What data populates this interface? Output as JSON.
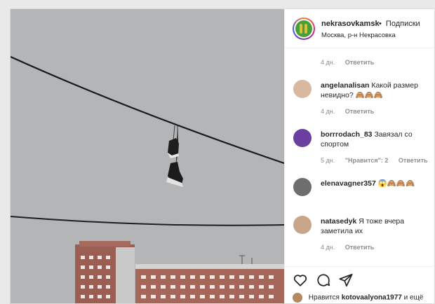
{
  "post": {
    "username": "nekrasovkamsk",
    "follow_separator": "•",
    "follow_label": "Подписки",
    "location": "Москва, р-н Некрасовка",
    "first_comment_meta": {
      "time": "4 дн.",
      "reply": "Ответить"
    }
  },
  "comments": [
    {
      "username": "angelanalisan",
      "text": "Какой размер невидно? 🙈🙈🙈",
      "time": "4 дн.",
      "likes": "",
      "reply": "Ответить",
      "avatar_color": "#d9b8a0"
    },
    {
      "username": "borrrodach_83",
      "text": "Завязал со спортом",
      "time": "5 дн.",
      "likes": "\"Нравится\": 2",
      "reply": "Ответить",
      "avatar_color": "#6a3fa0"
    },
    {
      "username": "elenavagner357",
      "text": "😱🙈🙈🙈",
      "time": "",
      "likes": "",
      "reply": "",
      "avatar_color": "#6e6e6e"
    },
    {
      "username": "natasedyk",
      "text": "Я тоже вчера заметила их",
      "time": "4 дн.",
      "likes": "",
      "reply": "Ответить",
      "avatar_color": "#c9a58a"
    }
  ],
  "actions": {
    "icons": [
      "heart-icon",
      "comment-icon",
      "share-icon"
    ],
    "likes_prefix": "Нравится",
    "likes_user": "kotovaalyona1977",
    "likes_suffix": "и ещё"
  },
  "colors": {
    "sky": "#b4b5b7",
    "text": "#262626",
    "muted": "#8e8e8e",
    "border": "#dbdbdb"
  }
}
